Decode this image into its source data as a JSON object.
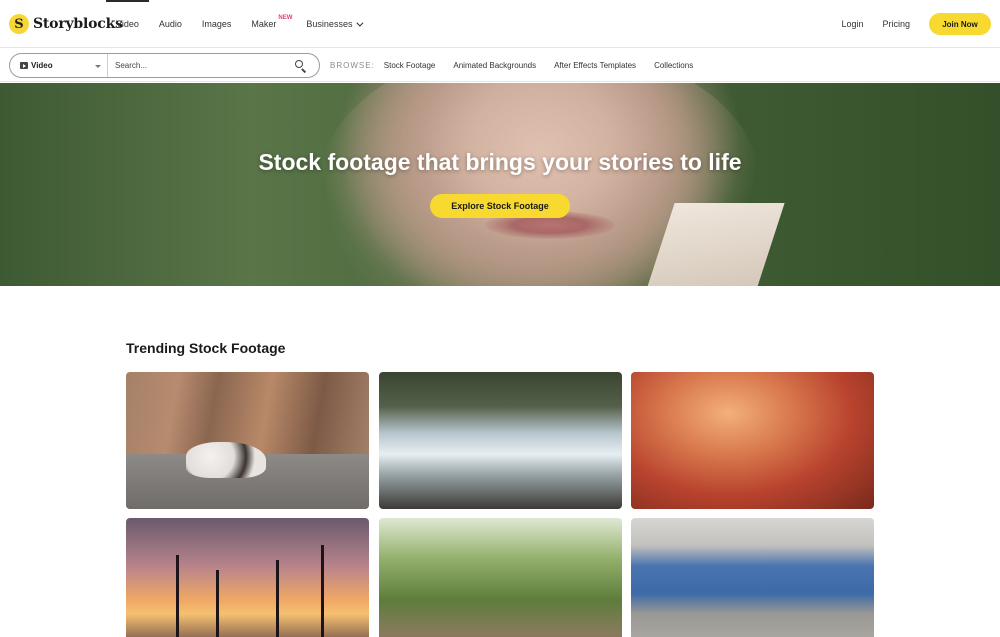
{
  "brand": {
    "name": "Storyblocks",
    "mark": "S"
  },
  "nav": {
    "links": [
      {
        "label": "Video",
        "active": true
      },
      {
        "label": "Audio"
      },
      {
        "label": "Images"
      },
      {
        "label": "Maker",
        "badge": "NEW"
      },
      {
        "label": "Businesses"
      }
    ],
    "login": "Login",
    "pricing": "Pricing",
    "join": "Join Now"
  },
  "search": {
    "type": "Video",
    "placeholder": "Search...",
    "browse_label": "BROWSE:",
    "browse_links": [
      "Stock Footage",
      "Animated Backgrounds",
      "After Effects Templates",
      "Collections"
    ]
  },
  "hero": {
    "title": "Stock footage that brings your stories to life",
    "cta": "Explore Stock Footage"
  },
  "trending": {
    "title": "Trending Stock Footage",
    "thumbnail_count": 6
  },
  "colors": {
    "accent": "#f8d92f",
    "badge": "#e63a7b"
  }
}
